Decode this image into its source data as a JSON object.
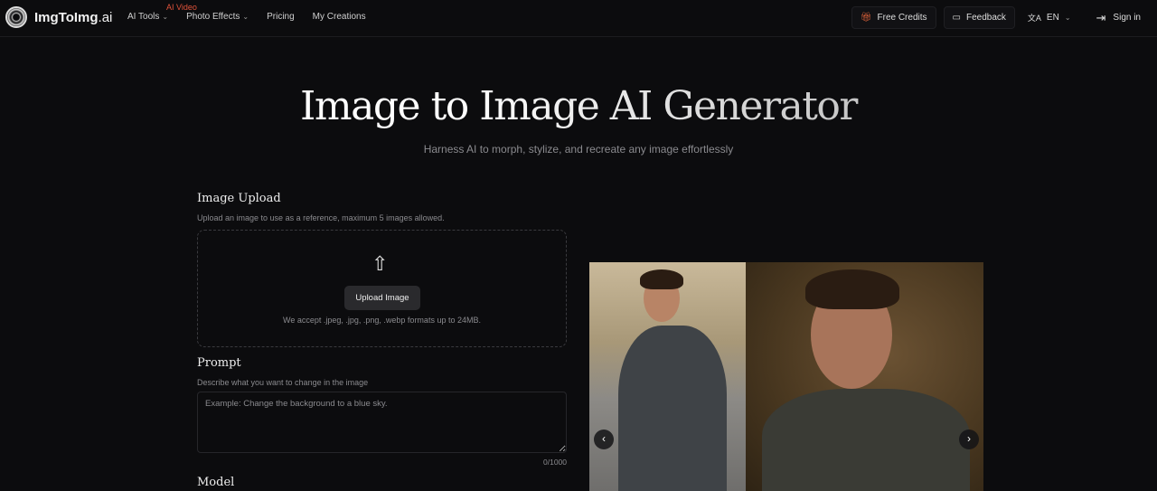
{
  "nav": {
    "logo": "ImgToImg",
    "logo_suffix": ".ai",
    "items": [
      {
        "label": "AI Tools"
      },
      {
        "label": "Photo Effects"
      },
      {
        "label": "Pricing"
      },
      {
        "label": "My Creations"
      }
    ],
    "badge": "AI Video",
    "free_credits": "Free Credits",
    "feedback": "Feedback",
    "language": "EN",
    "sign_in": "Sign in"
  },
  "hero": {
    "title": "Image to Image AI Generator",
    "subtitle": "Harness AI to morph, stylize, and recreate any image effortlessly"
  },
  "upload": {
    "title": "Image Upload",
    "description": "Upload an image to use as a reference, maximum 5 images allowed.",
    "button": "Upload Image",
    "note": "We accept .jpeg, .jpg, .png, .webp formats up to 24MB."
  },
  "prompt": {
    "title": "Prompt",
    "description": "Describe what you want to change in the image",
    "placeholder": "Example: Change the background to a blue sky.",
    "value": "",
    "count": "0/1000"
  },
  "model": {
    "title": "Model"
  },
  "colors": {
    "accent": "#e0533a",
    "background": "#0c0c0e"
  }
}
